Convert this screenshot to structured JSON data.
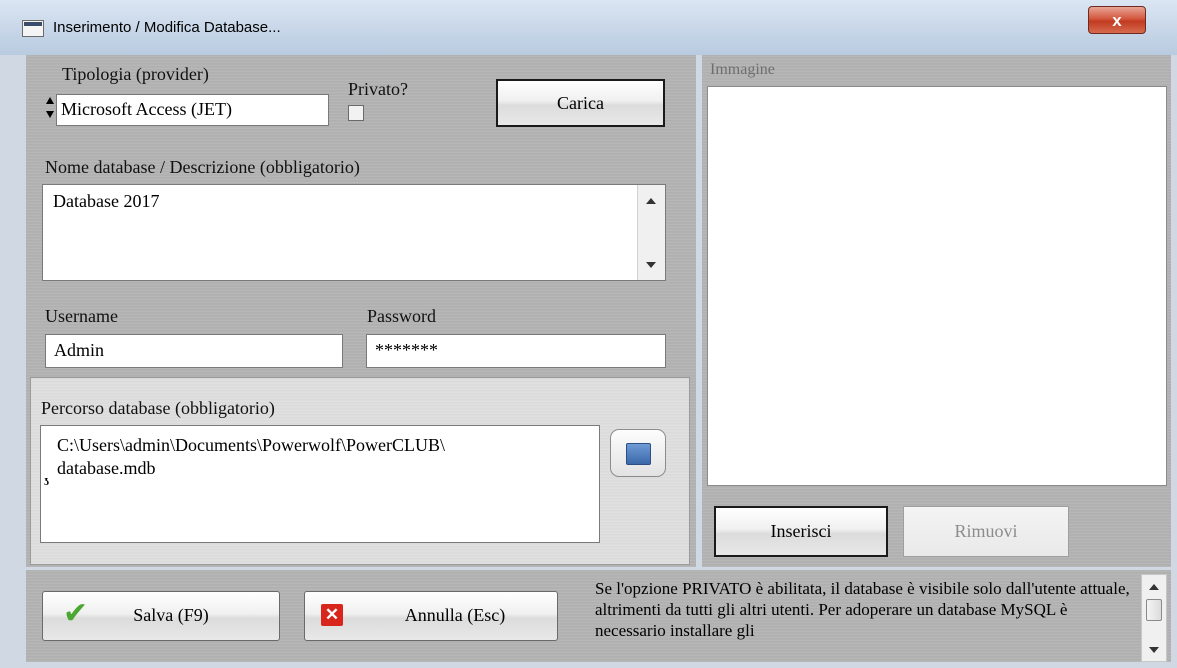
{
  "window": {
    "title": "Inserimento / Modifica Database...",
    "close_label": "x"
  },
  "provider": {
    "label": "Tipologia (provider)",
    "value": "Microsoft Access (JET)"
  },
  "private": {
    "label": "Privato?",
    "checked": false
  },
  "load_button": "Carica",
  "description": {
    "label": "Nome database / Descrizione (obbligatorio)",
    "value": "Database 2017"
  },
  "username": {
    "label": "Username",
    "value": "Admin"
  },
  "password": {
    "label": "Password",
    "value": "*******"
  },
  "path": {
    "label": "Percorso database (obbligatorio)",
    "line1": "C:\\Users\\admin\\Documents\\Powerwolf\\PowerCLUB\\",
    "line2": "database.mdb"
  },
  "image": {
    "label": "Immagine",
    "insert_button": "Inserisci",
    "remove_button": "Rimuovi"
  },
  "footer": {
    "save_button": "Salva (F9)",
    "cancel_button": "Annulla (Esc)",
    "info_text": "Se l'opzione PRIVATO è abilitata, il database è visibile solo dall'utente attuale, altrimenti da tutti gli altri utenti. Per adoperare un database MySQL è necessario installare gli"
  },
  "colors": {
    "close": "#c13b22",
    "check_icon": "#4aa832",
    "cancel_icon": "#d9261c",
    "folder_icon": "#4a79b8"
  }
}
